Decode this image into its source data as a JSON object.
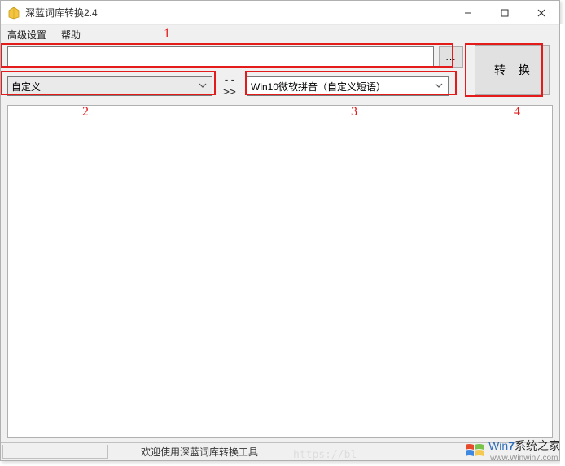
{
  "window": {
    "title": "深蓝词库转换2.4"
  },
  "menu": {
    "advanced": "高级设置",
    "help": "帮助"
  },
  "controls": {
    "file_input_value": "",
    "browse_label": "...",
    "source_combo": "自定义",
    "arrow_label": "-->>",
    "target_combo": "Win10微软拼音（自定义短语）",
    "convert_label": "转 换"
  },
  "status": {
    "message": "欢迎使用深蓝词库转换工具"
  },
  "annotations": {
    "n1": "1",
    "n2": "2",
    "n3": "3",
    "n4": "4"
  },
  "watermark": {
    "brand_prefix": "Win",
    "brand_seven": "7",
    "brand_suffix": "系统之家",
    "url": "www.Winwin7.com"
  },
  "faint_url": "https://bl"
}
